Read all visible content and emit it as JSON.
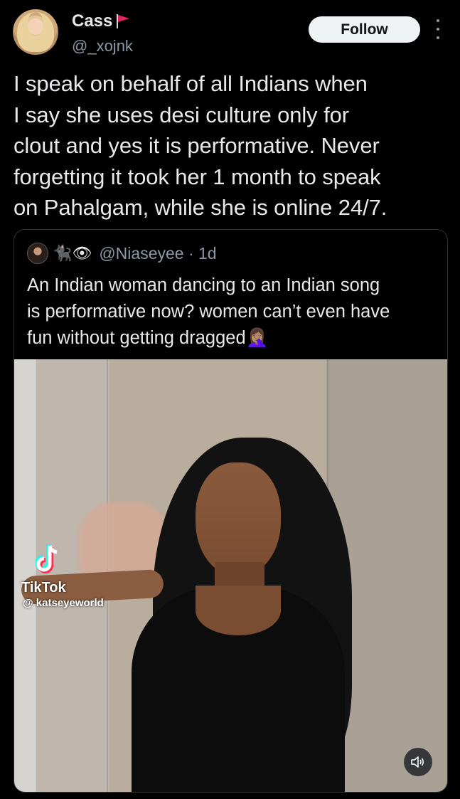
{
  "author": {
    "name": "Cass",
    "handle": "@_xojnk",
    "flag_icon": "red-flag-icon",
    "flag_color": "#e0245e"
  },
  "follow_label": "Follow",
  "tweet_lines": [
    "I speak on behalf of all Indians when",
    "I say she uses desi culture only for",
    "clout and yes it is performative. Never",
    "forgetting it took her 1 month to speak",
    "on Pahalgam, while she is online 24/7."
  ],
  "quote": {
    "handle_line": "@Niaseyee · 1d",
    "name_emojis": "🐈‍⬛👁",
    "text_lines": [
      "An Indian woman dancing to an Indian song",
      "is performative now? women can’t even have",
      "fun without getting dragged🤦🏽‍♀️"
    ]
  },
  "media": {
    "watermark_brand": "TikTok",
    "watermark_user": "@ katseyeworld",
    "mute_icon": "speaker-muted-icon"
  },
  "colors": {
    "background": "#000000",
    "text_primary": "#e7e9ea",
    "text_secondary": "#8b98a5",
    "follow_bg": "#eff3f4"
  }
}
